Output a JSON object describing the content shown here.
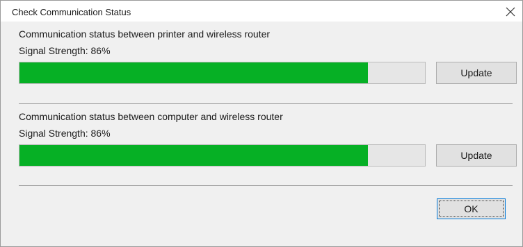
{
  "window": {
    "title": "Check Communication Status",
    "close_icon": "close-icon"
  },
  "sections": [
    {
      "label": "Communication status between printer and wireless router",
      "strength_text": "Signal Strength: 86%",
      "strength_fraction": 0.86,
      "update_label": "Update"
    },
    {
      "label": "Communication status between computer and wireless router",
      "strength_text": "Signal Strength: 86%",
      "strength_fraction": 0.86,
      "update_label": "Update"
    }
  ],
  "footer": {
    "ok_label": "OK"
  },
  "colors": {
    "progress_fill": "#06b025",
    "progress_track": "#e6e6e6",
    "focus_border": "#0078d7"
  }
}
